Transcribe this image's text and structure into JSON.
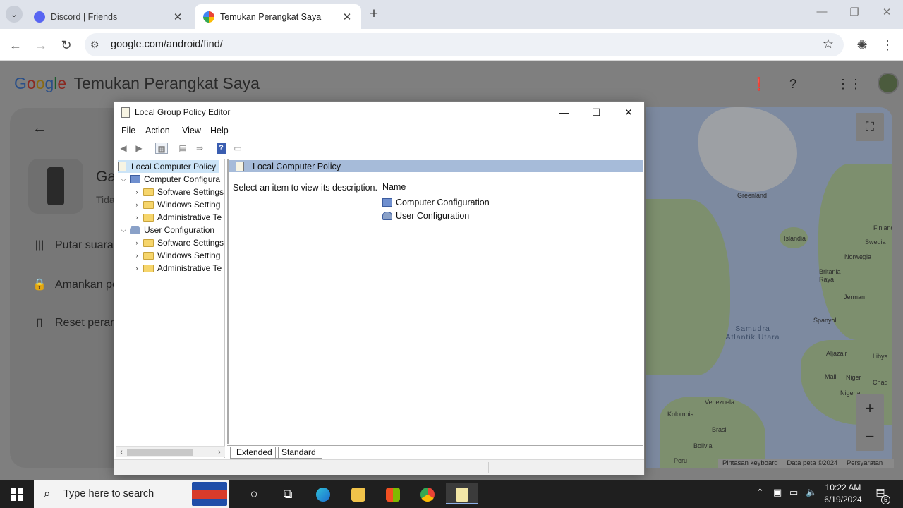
{
  "browser": {
    "tabs": [
      {
        "title": "Discord | Friends",
        "favicon_color": "#5865f2"
      },
      {
        "title": "Temukan Perangkat Saya",
        "favicon_color": "#34a853",
        "active": true
      }
    ],
    "url": "google.com/android/find/"
  },
  "page": {
    "brand_letters": [
      "G",
      "o",
      "o",
      "g",
      "l",
      "e"
    ],
    "product": "Temukan Perangkat Saya",
    "device_name": "Ga",
    "device_status": "Tida",
    "actions": [
      {
        "label": "Putar suara",
        "icon": "sound-wave-icon"
      },
      {
        "label": "Amankan pe",
        "icon": "lock-icon"
      },
      {
        "label": "Reset peran",
        "icon": "phone-erase-icon"
      }
    ],
    "map": {
      "labels": [
        "Greenland",
        "Islandia",
        "Finlandia",
        "Swedia",
        "Norwegia",
        "Britania Raya",
        "Jerman",
        "Spanyol",
        "Aljazair",
        "Libya",
        "Mali",
        "Niger",
        "Chad",
        "Nigeria",
        "Venezuela",
        "Kolombia",
        "Brasil",
        "Bolivia",
        "Peru"
      ],
      "sea_label": "Samudra Atlantik Utara",
      "attribution": [
        "Pintasan keyboard",
        "Data peta ©2024",
        "Persyaratan"
      ]
    }
  },
  "gpe": {
    "title": "Local Group Policy Editor",
    "menu": [
      "File",
      "Action",
      "View",
      "Help"
    ],
    "tree": [
      {
        "label": "Local Computer Policy",
        "level": 0,
        "selected": true,
        "icon": "doc"
      },
      {
        "label": "Computer Configura",
        "level": 1,
        "expanded": true,
        "icon": "pc"
      },
      {
        "label": "Software Settings",
        "level": 2,
        "icon": "folder"
      },
      {
        "label": "Windows Setting",
        "level": 2,
        "icon": "folder"
      },
      {
        "label": "Administrative Te",
        "level": 2,
        "icon": "folder"
      },
      {
        "label": "User Configuration",
        "level": 1,
        "expanded": true,
        "icon": "user"
      },
      {
        "label": "Software Settings",
        "level": 2,
        "icon": "folder"
      },
      {
        "label": "Windows Setting",
        "level": 2,
        "icon": "folder"
      },
      {
        "label": "Administrative Te",
        "level": 2,
        "icon": "folder"
      }
    ],
    "header": "Local Computer Policy",
    "description": "Select an item to view its description.",
    "column": "Name",
    "items": [
      "Computer Configuration",
      "User Configuration"
    ],
    "view_tabs": [
      "Extended",
      "Standard"
    ]
  },
  "taskbar": {
    "search_placeholder": "Type here to search",
    "time": "10:22 AM",
    "date": "6/19/2024",
    "notifications": "5"
  }
}
